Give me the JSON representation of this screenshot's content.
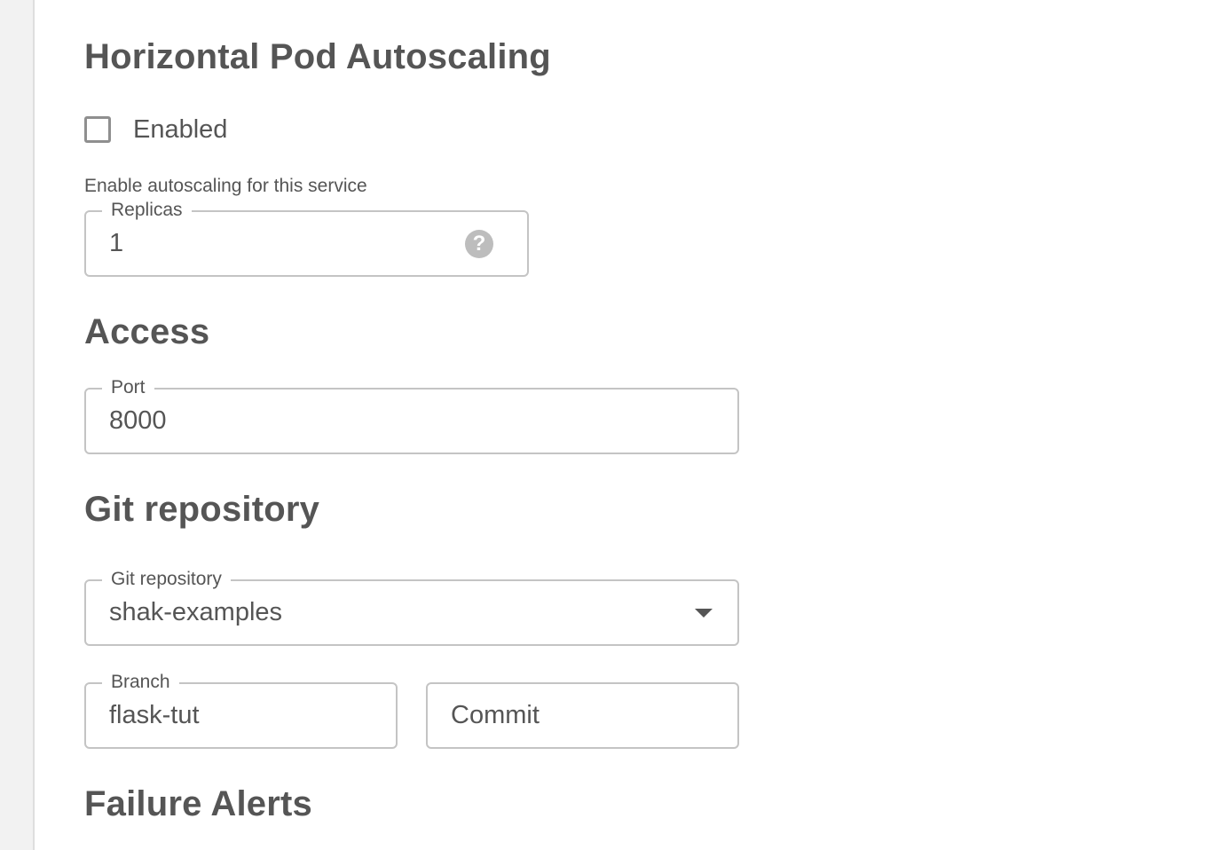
{
  "hpa": {
    "title": "Horizontal Pod Autoscaling",
    "enabled_label": "Enabled",
    "enabled_checked": false,
    "helper_text": "Enable autoscaling for this service",
    "replicas_label": "Replicas",
    "replicas_value": "1",
    "help_icon": "help-circle-icon"
  },
  "access": {
    "title": "Access",
    "port_label": "Port",
    "port_value": "8000"
  },
  "git": {
    "title": "Git repository",
    "repo_label": "Git repository",
    "repo_value": "shak-examples",
    "dropdown_icon": "caret-down-icon",
    "branch_label": "Branch",
    "branch_value": "flask-tut",
    "commit_placeholder": "Commit"
  },
  "failure_alerts": {
    "title": "Failure Alerts"
  },
  "colors": {
    "text": "#555555",
    "border": "#c4c4c4",
    "rail": "#f2f2f2",
    "help_icon": "#bdbdbd"
  }
}
